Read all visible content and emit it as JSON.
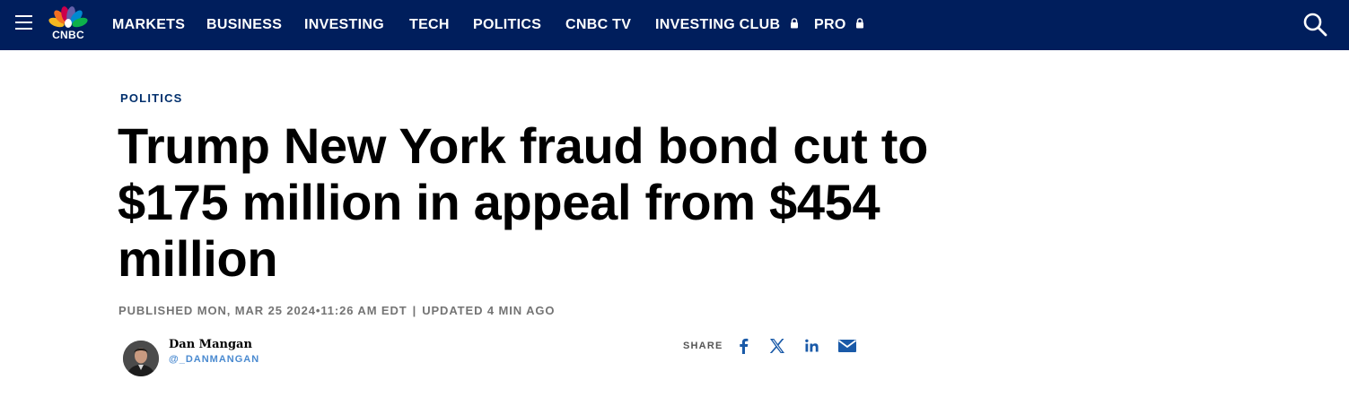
{
  "brand": {
    "logo_text": "CNBC"
  },
  "nav": {
    "items": [
      {
        "label": "MARKETS",
        "locked": false
      },
      {
        "label": "BUSINESS",
        "locked": false
      },
      {
        "label": "INVESTING",
        "locked": false
      },
      {
        "label": "TECH",
        "locked": false
      },
      {
        "label": "POLITICS",
        "locked": false
      },
      {
        "label": "CNBC TV",
        "locked": false
      },
      {
        "label": "INVESTING CLUB",
        "locked": true
      },
      {
        "label": "PRO",
        "locked": true
      }
    ],
    "icons": {
      "menu": "hamburger-menu-icon",
      "search": "search-icon",
      "lock": "lock-icon"
    }
  },
  "article": {
    "section": "POLITICS",
    "headline": "Trump New York fraud bond cut to $175 million in appeal from $454 million",
    "published": "PUBLISHED MON, MAR 25 2024•11:26 AM EDT",
    "separator": "|",
    "updated": "UPDATED 4 MIN AGO"
  },
  "author": {
    "name": "Dan Mangan",
    "handle": "@_DANMANGAN"
  },
  "share": {
    "label": "SHARE",
    "buttons": [
      "facebook-icon",
      "x-twitter-icon",
      "linkedin-icon",
      "email-icon"
    ]
  },
  "colors": {
    "nav_bg": "#001e5c",
    "section_link": "#002f6c",
    "byline_gray": "#747474",
    "handle_blue": "#4a8ad0",
    "share_blue": "#1a5aa8"
  }
}
